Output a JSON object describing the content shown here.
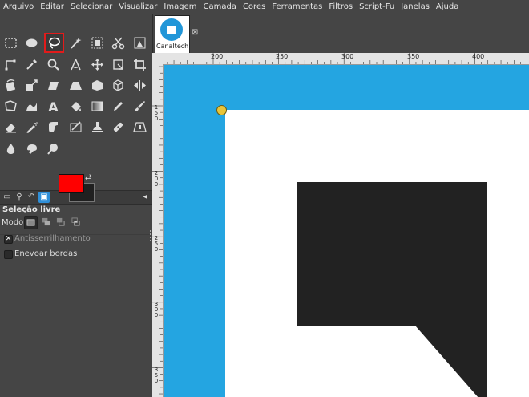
{
  "menubar": {
    "items": [
      "Arquivo",
      "Editar",
      "Selecionar",
      "Visualizar",
      "Imagem",
      "Camada",
      "Cores",
      "Ferramentas",
      "Filtros",
      "Script-Fu",
      "Janelas",
      "Ajuda"
    ]
  },
  "toolbox": {
    "active_tool": "free-select-tool",
    "foreground_color": "#ff0000",
    "background_color": "#202020"
  },
  "tool_options": {
    "title": "Seleção livre",
    "mode_label": "Modo:",
    "antialiasing_label": "Antisserrilhamento",
    "antialiasing_checked": true,
    "feather_label": "Enevoar bordas",
    "feather_checked": false
  },
  "image_tab": {
    "label": "Canaltech"
  },
  "ruler": {
    "h_labels": [
      "200",
      "250",
      "300",
      "350",
      "400"
    ],
    "v_labels": [
      "150",
      "200",
      "250",
      "300",
      "350"
    ]
  },
  "canvas": {
    "outer_color": "#24a5e1",
    "page_color": "#ffffff",
    "shape_color": "#222222",
    "handle_color": "#e8c53a"
  }
}
